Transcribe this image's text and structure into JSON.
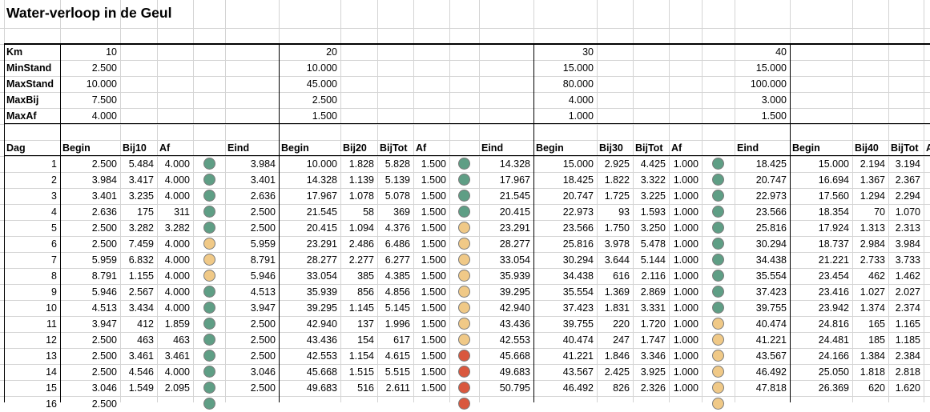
{
  "title": "Water-verloop in de Geul",
  "colors": {
    "green": "#5f9e85",
    "yellow": "#f0c987",
    "red": "#d9583e"
  },
  "params": {
    "labels": [
      "Km",
      "MinStand",
      "MaxStand",
      "MaxBij",
      "MaxAf"
    ],
    "groups": [
      [
        "10",
        "2.500",
        "10.000",
        "7.500",
        "4.000"
      ],
      [
        "20",
        "10.000",
        "45.000",
        "2.500",
        "1.500"
      ],
      [
        "30",
        "15.000",
        "80.000",
        "4.000",
        "1.000"
      ],
      [
        "40",
        "15.000",
        "100.000",
        "3.000",
        "1.500"
      ]
    ]
  },
  "headers": [
    "Dag",
    "Begin",
    "Bij10",
    "Af",
    "Eind",
    "Begin",
    "Bij20",
    "BijTot",
    "Af",
    "Eind",
    "Begin",
    "Bij30",
    "BijTot",
    "Af",
    "Eind",
    "Begin",
    "Bij40",
    "BijTot",
    "A"
  ],
  "rows": [
    {
      "dag": "1",
      "g1": [
        "2.500",
        "5.484",
        "4.000",
        "g",
        "3.984"
      ],
      "g2": [
        "10.000",
        "1.828",
        "5.828",
        "1.500",
        "g",
        "14.328"
      ],
      "g3": [
        "15.000",
        "2.925",
        "4.425",
        "1.000",
        "g",
        "18.425"
      ],
      "g4": [
        "15.000",
        "2.194",
        "3.194"
      ]
    },
    {
      "dag": "2",
      "g1": [
        "3.984",
        "3.417",
        "4.000",
        "g",
        "3.401"
      ],
      "g2": [
        "14.328",
        "1.139",
        "5.139",
        "1.500",
        "g",
        "17.967"
      ],
      "g3": [
        "18.425",
        "1.822",
        "3.322",
        "1.000",
        "g",
        "20.747"
      ],
      "g4": [
        "16.694",
        "1.367",
        "2.367"
      ]
    },
    {
      "dag": "3",
      "g1": [
        "3.401",
        "3.235",
        "4.000",
        "g",
        "2.636"
      ],
      "g2": [
        "17.967",
        "1.078",
        "5.078",
        "1.500",
        "g",
        "21.545"
      ],
      "g3": [
        "20.747",
        "1.725",
        "3.225",
        "1.000",
        "g",
        "22.973"
      ],
      "g4": [
        "17.560",
        "1.294",
        "2.294"
      ]
    },
    {
      "dag": "4",
      "g1": [
        "2.636",
        "175",
        "311",
        "g",
        "2.500"
      ],
      "g2": [
        "21.545",
        "58",
        "369",
        "1.500",
        "g",
        "20.415"
      ],
      "g3": [
        "22.973",
        "93",
        "1.593",
        "1.000",
        "g",
        "23.566"
      ],
      "g4": [
        "18.354",
        "70",
        "1.070"
      ]
    },
    {
      "dag": "5",
      "g1": [
        "2.500",
        "3.282",
        "3.282",
        "g",
        "2.500"
      ],
      "g2": [
        "20.415",
        "1.094",
        "4.376",
        "1.500",
        "y",
        "23.291"
      ],
      "g3": [
        "23.566",
        "1.750",
        "3.250",
        "1.000",
        "g",
        "25.816"
      ],
      "g4": [
        "17.924",
        "1.313",
        "2.313"
      ]
    },
    {
      "dag": "6",
      "g1": [
        "2.500",
        "7.459",
        "4.000",
        "y",
        "5.959"
      ],
      "g2": [
        "23.291",
        "2.486",
        "6.486",
        "1.500",
        "y",
        "28.277"
      ],
      "g3": [
        "25.816",
        "3.978",
        "5.478",
        "1.000",
        "g",
        "30.294"
      ],
      "g4": [
        "18.737",
        "2.984",
        "3.984"
      ]
    },
    {
      "dag": "7",
      "g1": [
        "5.959",
        "6.832",
        "4.000",
        "y",
        "8.791"
      ],
      "g2": [
        "28.277",
        "2.277",
        "6.277",
        "1.500",
        "y",
        "33.054"
      ],
      "g3": [
        "30.294",
        "3.644",
        "5.144",
        "1.000",
        "g",
        "34.438"
      ],
      "g4": [
        "21.221",
        "2.733",
        "3.733"
      ]
    },
    {
      "dag": "8",
      "g1": [
        "8.791",
        "1.155",
        "4.000",
        "y",
        "5.946"
      ],
      "g2": [
        "33.054",
        "385",
        "4.385",
        "1.500",
        "y",
        "35.939"
      ],
      "g3": [
        "34.438",
        "616",
        "2.116",
        "1.000",
        "g",
        "35.554"
      ],
      "g4": [
        "23.454",
        "462",
        "1.462"
      ]
    },
    {
      "dag": "9",
      "g1": [
        "5.946",
        "2.567",
        "4.000",
        "g",
        "4.513"
      ],
      "g2": [
        "35.939",
        "856",
        "4.856",
        "1.500",
        "y",
        "39.295"
      ],
      "g3": [
        "35.554",
        "1.369",
        "2.869",
        "1.000",
        "g",
        "37.423"
      ],
      "g4": [
        "23.416",
        "1.027",
        "2.027"
      ]
    },
    {
      "dag": "10",
      "g1": [
        "4.513",
        "3.434",
        "4.000",
        "g",
        "3.947"
      ],
      "g2": [
        "39.295",
        "1.145",
        "5.145",
        "1.500",
        "y",
        "42.940"
      ],
      "g3": [
        "37.423",
        "1.831",
        "3.331",
        "1.000",
        "g",
        "39.755"
      ],
      "g4": [
        "23.942",
        "1.374",
        "2.374"
      ]
    },
    {
      "dag": "11",
      "g1": [
        "3.947",
        "412",
        "1.859",
        "g",
        "2.500"
      ],
      "g2": [
        "42.940",
        "137",
        "1.996",
        "1.500",
        "y",
        "43.436"
      ],
      "g3": [
        "39.755",
        "220",
        "1.720",
        "1.000",
        "y",
        "40.474"
      ],
      "g4": [
        "24.816",
        "165",
        "1.165"
      ]
    },
    {
      "dag": "12",
      "g1": [
        "2.500",
        "463",
        "463",
        "g",
        "2.500"
      ],
      "g2": [
        "43.436",
        "154",
        "617",
        "1.500",
        "y",
        "42.553"
      ],
      "g3": [
        "40.474",
        "247",
        "1.747",
        "1.000",
        "y",
        "41.221"
      ],
      "g4": [
        "24.481",
        "185",
        "1.185"
      ]
    },
    {
      "dag": "13",
      "g1": [
        "2.500",
        "3.461",
        "3.461",
        "g",
        "2.500"
      ],
      "g2": [
        "42.553",
        "1.154",
        "4.615",
        "1.500",
        "r",
        "45.668"
      ],
      "g3": [
        "41.221",
        "1.846",
        "3.346",
        "1.000",
        "y",
        "43.567"
      ],
      "g4": [
        "24.166",
        "1.384",
        "2.384"
      ]
    },
    {
      "dag": "14",
      "g1": [
        "2.500",
        "4.546",
        "4.000",
        "g",
        "3.046"
      ],
      "g2": [
        "45.668",
        "1.515",
        "5.515",
        "1.500",
        "r",
        "49.683"
      ],
      "g3": [
        "43.567",
        "2.425",
        "3.925",
        "1.000",
        "y",
        "46.492"
      ],
      "g4": [
        "25.050",
        "1.818",
        "2.818"
      ]
    },
    {
      "dag": "15",
      "g1": [
        "3.046",
        "1.549",
        "2.095",
        "g",
        "2.500"
      ],
      "g2": [
        "49.683",
        "516",
        "2.611",
        "1.500",
        "r",
        "50.795"
      ],
      "g3": [
        "46.492",
        "826",
        "2.326",
        "1.000",
        "y",
        "47.818"
      ],
      "g4": [
        "26.369",
        "620",
        "1.620"
      ]
    },
    {
      "dag": "16",
      "g1": [
        "2.500",
        "",
        "",
        "g",
        ""
      ],
      "g2": [
        "",
        "",
        "",
        "",
        "r",
        ""
      ],
      "g3": [
        "",
        "",
        "",
        "",
        "y",
        ""
      ],
      "g4": [
        "",
        "",
        ""
      ]
    }
  ]
}
